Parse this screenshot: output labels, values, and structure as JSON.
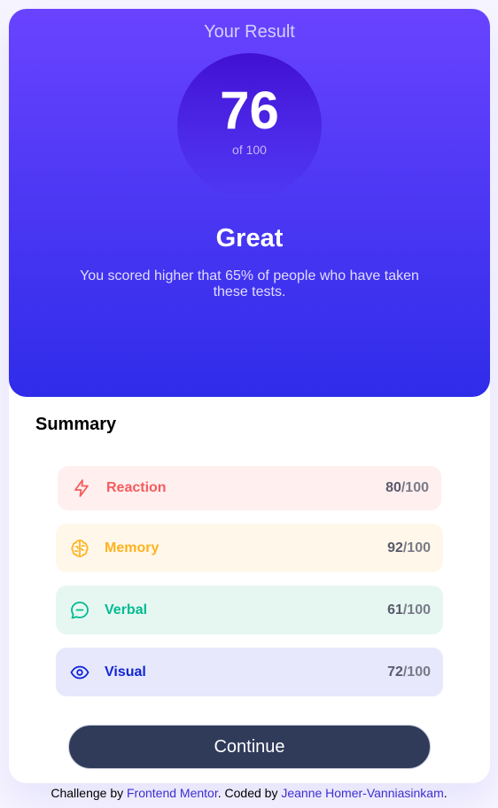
{
  "result": {
    "title": "Your Result",
    "score": "76",
    "of_label": "of 100",
    "rating": "Great",
    "description": "You scored higher that 65% of people who have taken these tests."
  },
  "summary": {
    "title": "Summary",
    "items": [
      {
        "label": "Reaction",
        "score": "80",
        "max": "/100",
        "icon": "lightning-icon",
        "color": "#f55d5d",
        "bg": "#ffefef"
      },
      {
        "label": "Memory",
        "score": "92",
        "max": "/100",
        "icon": "brain-icon",
        "color": "#ffb21e",
        "bg": "#fff8ea"
      },
      {
        "label": "Verbal",
        "score": "61",
        "max": "/100",
        "icon": "chat-bubble-icon",
        "color": "#00bb8f",
        "bg": "#e6f7f2"
      },
      {
        "label": "Visual",
        "score": "72",
        "max": "/100",
        "icon": "eye-icon",
        "color": "#1125d6",
        "bg": "#e7e8fb"
      }
    ]
  },
  "continue_label": "Continue",
  "attribution": {
    "prefix": "Challenge by ",
    "mentor_link": "Frontend Mentor",
    "middle": ". Coded by ",
    "author_link": "Jeanne Homer-Vanniasinkam",
    "suffix": "."
  },
  "colors": {
    "gradient_top": "#6943ff",
    "gradient_bottom": "#2f2ce9",
    "button": "#303b5a"
  }
}
